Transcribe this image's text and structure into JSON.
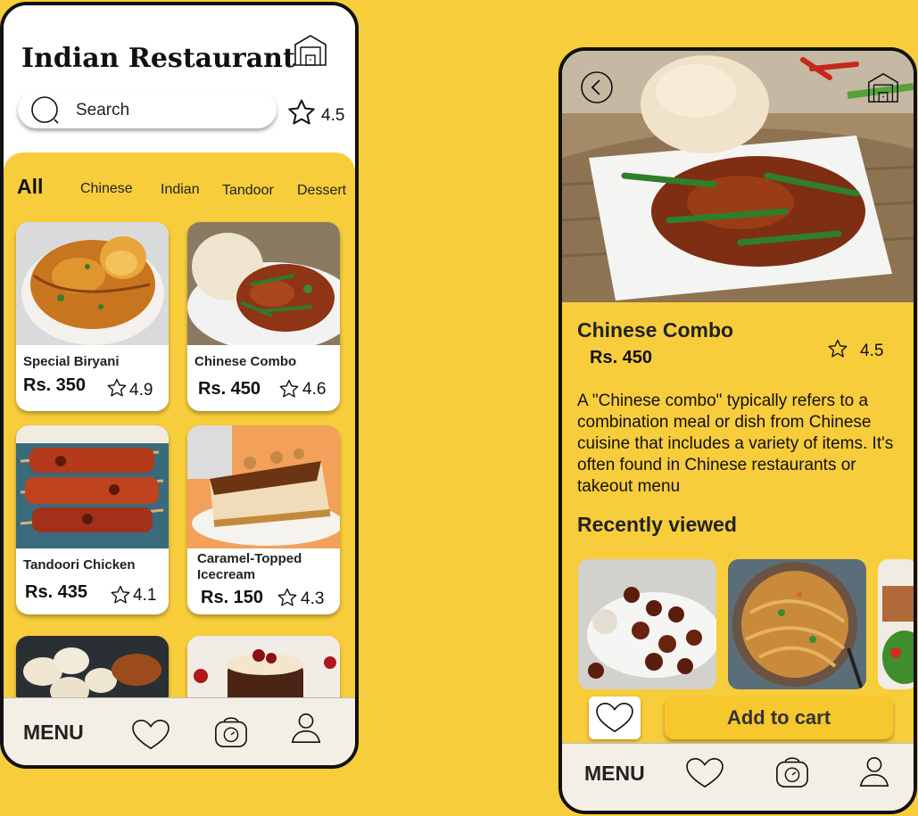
{
  "colors": {
    "background": "#f8cd3b",
    "card": "#ffffff",
    "navbar": "#f3efe6",
    "text": "#111111",
    "button": "#f7c72e"
  },
  "home": {
    "title": "Indian Restaurant",
    "search_placeholder": "Search",
    "rating": "4.5",
    "categories": [
      "All",
      "Chinese",
      "Indian",
      "Tandoor",
      "Dessert"
    ],
    "items": [
      {
        "name": "Special Biryani",
        "price": "Rs. 350",
        "rating": "4.9"
      },
      {
        "name": "Chinese Combo",
        "price": "Rs. 450",
        "rating": "4.6"
      },
      {
        "name": "Tandoori Chicken",
        "price": "Rs. 435",
        "rating": "4.1"
      },
      {
        "name": "Caramel-Topped Icecream",
        "name_line1": "Caramel-Topped",
        "name_line2": "Icecream",
        "price": "Rs. 150",
        "rating": "4.3"
      }
    ],
    "nav": {
      "menu_label": "MENU",
      "icons": [
        "heart-icon",
        "bag-icon",
        "profile-icon"
      ]
    }
  },
  "detail": {
    "title": "Chinese Combo",
    "price": "Rs. 450",
    "rating": "4.5",
    "description": "A \"Chinese combo\" typically refers to a combination meal or dish from Chinese cuisine that includes a variety of items. It's often found in Chinese restaurants or takeout menu",
    "recently_viewed_label": "Recently viewed",
    "add_to_cart_label": "Add to cart",
    "nav": {
      "menu_label": "MENU"
    }
  }
}
